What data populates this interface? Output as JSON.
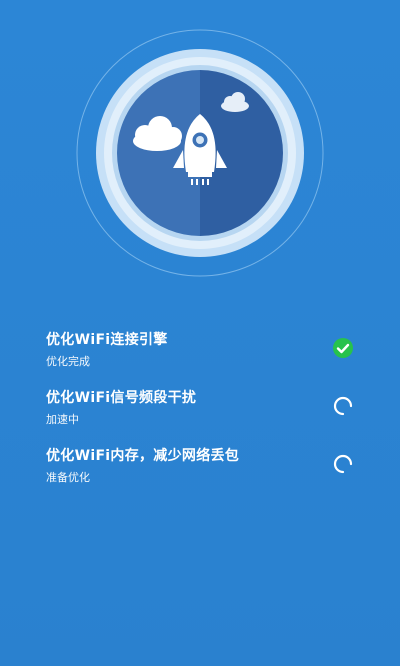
{
  "tasks": [
    {
      "title": "优化WiFi连接引擎",
      "status": "优化完成",
      "state": "done",
      "icon": "check-circle-icon"
    },
    {
      "title": "优化WiFi信号频段干扰",
      "status": "加速中",
      "state": "loading",
      "icon": "spinner-icon"
    },
    {
      "title": "优化WiFi内存，减少网络丢包",
      "status": "准备优化",
      "state": "loading",
      "icon": "spinner-icon"
    }
  ],
  "colors": {
    "background": "#2a82d0",
    "check": "#27c24c",
    "text": "#ffffff"
  },
  "hero_icons": [
    "rocket-icon",
    "cloud-icon"
  ]
}
